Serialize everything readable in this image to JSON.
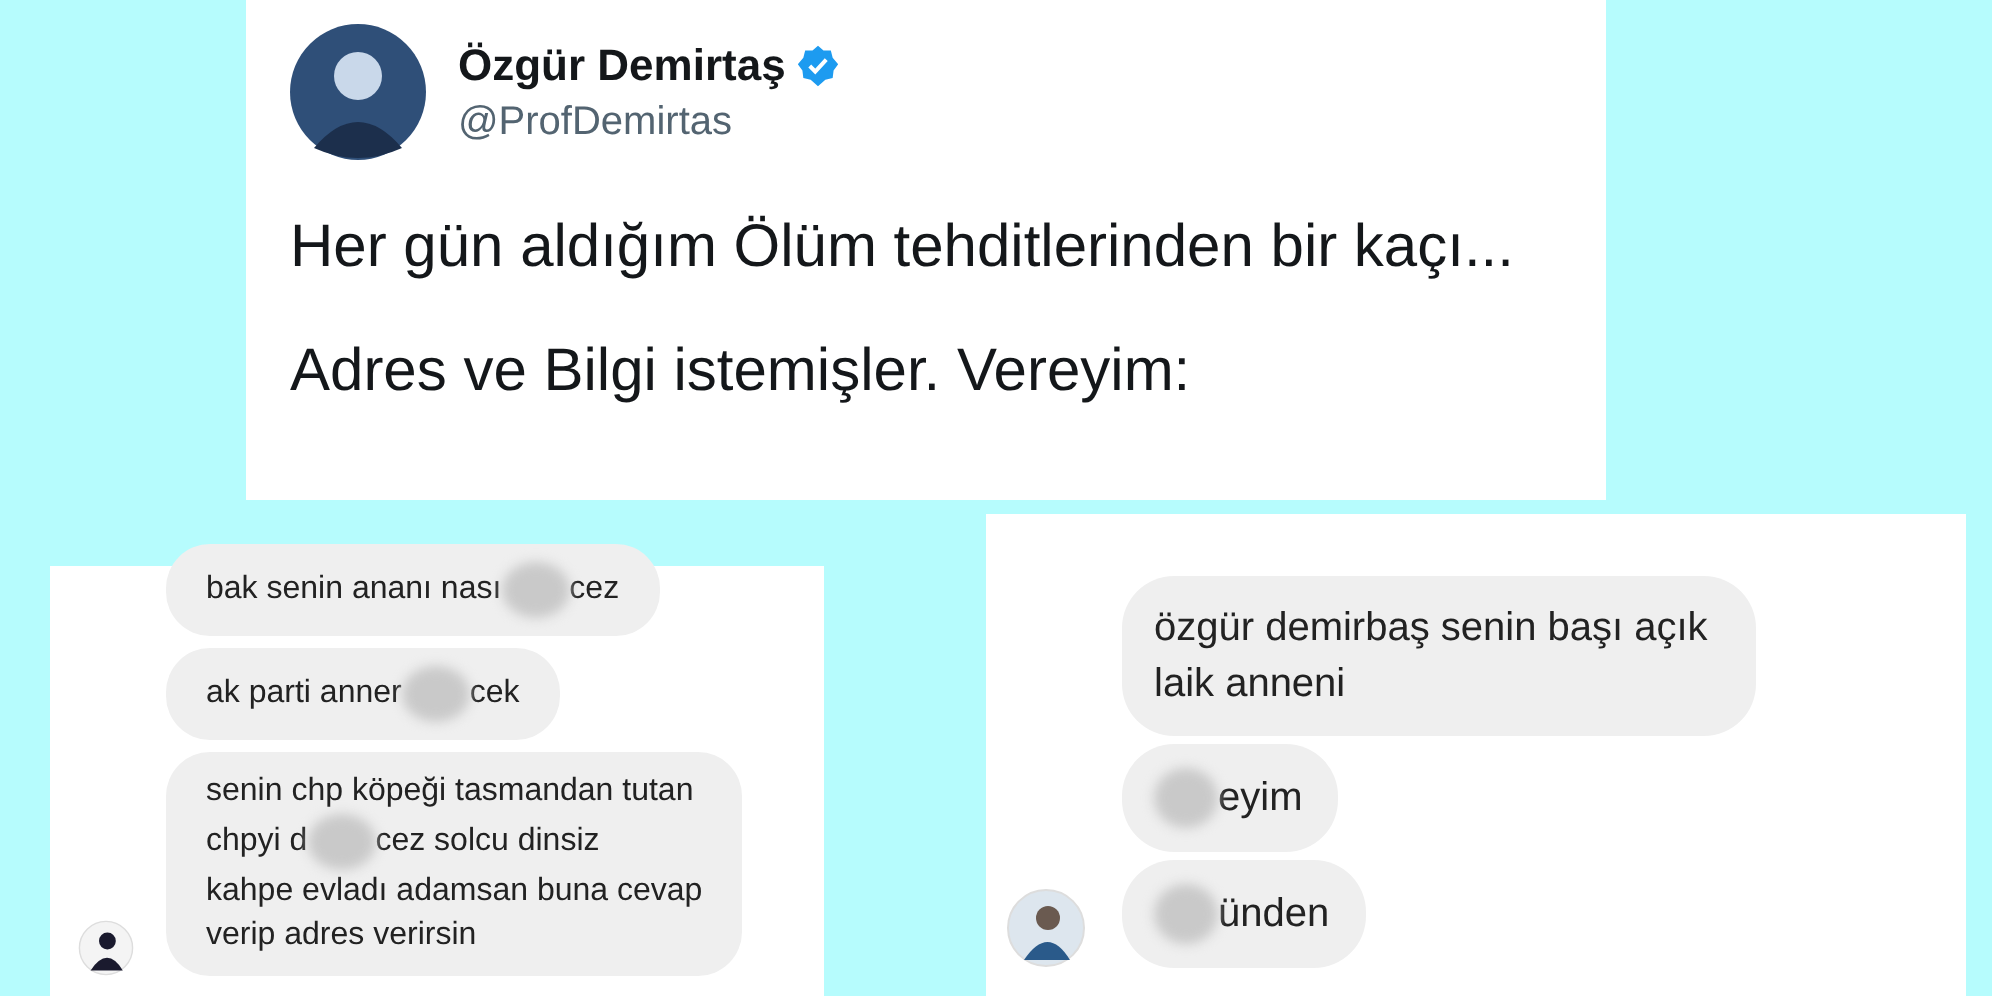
{
  "tweet": {
    "name": "Özgür Demirtaş",
    "verified": true,
    "handle": "@ProfDemirtas",
    "paragraphs": [
      "Her gün aldığım Ölüm tehditlerinden bir kaçı...",
      "Adres ve Bilgi istemişler. Vereyim:"
    ]
  },
  "chats": [
    {
      "bubbles": [
        {
          "lines": [
            [
              {
                "kind": "text",
                "text": "bak senin ananı nası"
              },
              {
                "kind": "blur"
              },
              {
                "kind": "text",
                "text": "cez"
              }
            ]
          ]
        },
        {
          "lines": [
            [
              {
                "kind": "text",
                "text": "ak parti anner"
              },
              {
                "kind": "blur"
              },
              {
                "kind": "text",
                "text": "cek"
              }
            ]
          ]
        },
        {
          "lines": [
            [
              {
                "kind": "text",
                "text": "senin chp köpeği tasmandan tutan"
              }
            ],
            [
              {
                "kind": "text",
                "text": "chpyi d"
              },
              {
                "kind": "blur"
              },
              {
                "kind": "text",
                "text": "cez solcu dinsiz"
              }
            ],
            [
              {
                "kind": "text",
                "text": "kahpe evladı adamsan buna cevap"
              }
            ],
            [
              {
                "kind": "text",
                "text": "verip adres verirsin"
              }
            ]
          ]
        }
      ]
    },
    {
      "bubbles": [
        {
          "lines": [
            [
              {
                "kind": "text",
                "text": "özgür demirbaş senin başı açık"
              }
            ],
            [
              {
                "kind": "text",
                "text": "laik anneni"
              }
            ]
          ]
        },
        {
          "lines": [
            [
              {
                "kind": "blur"
              },
              {
                "kind": "text",
                "text": "eyim"
              }
            ]
          ]
        },
        {
          "lines": [
            [
              {
                "kind": "blur"
              },
              {
                "kind": "text",
                "text": "ünden"
              }
            ]
          ]
        }
      ]
    }
  ]
}
